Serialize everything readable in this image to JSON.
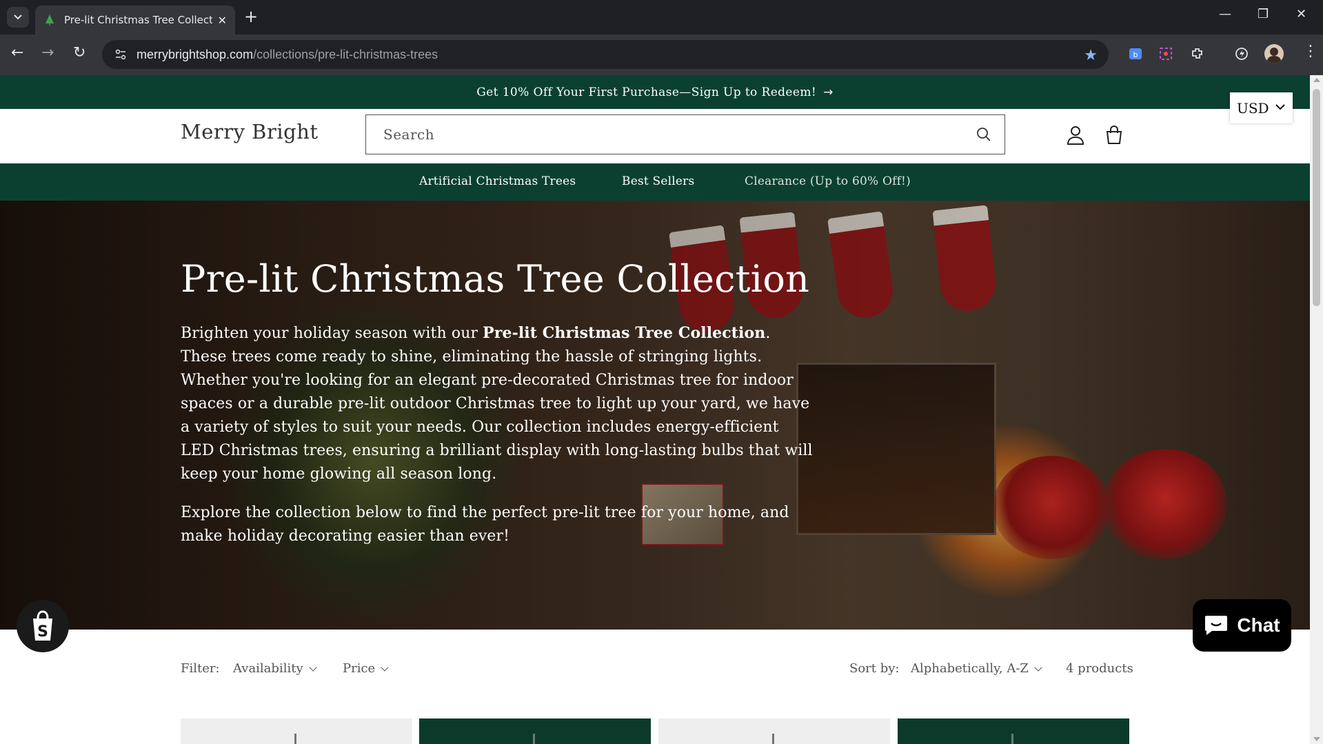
{
  "browser": {
    "tab_title": "Pre-lit Christmas Tree Collection",
    "tab_close": "✕",
    "new_tab": "+",
    "url_host": "merrybrightshop.com",
    "url_path": "/collections/pre-lit-christmas-trees",
    "window_controls": {
      "minimize": "—",
      "restore": "❐",
      "close": "✕"
    },
    "nav": {
      "back": "←",
      "forward": "→",
      "reload": "↻"
    }
  },
  "site": {
    "announcement": "Get 10% Off Your First Purchase—Sign Up to Redeem!",
    "announcement_arrow": "→",
    "currency": "USD",
    "logo": "Merry Bright",
    "search_placeholder": "Search",
    "nav": [
      {
        "label": "Artificial Christmas Trees"
      },
      {
        "label": "Best Sellers"
      },
      {
        "label": "Clearance (Up to 60% Off!)"
      }
    ],
    "brand_color": "#0b4030"
  },
  "hero": {
    "title": "Pre-lit Christmas Tree Collection",
    "p1_before": "Brighten your holiday season with our ",
    "p1_bold": "Pre-lit Christmas Tree Collection",
    "p1_after": ". These trees come ready to shine, eliminating the hassle of stringing lights. Whether you're looking for an elegant pre-decorated Christmas tree for indoor spaces or a durable pre-lit outdoor Christmas tree to light up your yard, we have a variety of styles to suit your needs. Our collection includes energy-efficient LED Christmas trees, ensuring a brilliant display with long-lasting bulbs that will keep your home glowing all season long.",
    "p2": "Explore the collection below to find the perfect pre-lit tree for your home, and make holiday decorating easier than ever!"
  },
  "filters": {
    "filter_label": "Filter:",
    "availability": "Availability",
    "price": "Price",
    "sort_label": "Sort by:",
    "sort_value": "Alphabetically, A-Z",
    "product_count": "4 products"
  },
  "products": [
    {
      "bg": "#eeeeee"
    },
    {
      "bg": "#0b3a2a"
    },
    {
      "bg": "#eeeeee"
    },
    {
      "bg": "#0b3a2a"
    }
  ],
  "chat": {
    "label": "Chat"
  },
  "icons": [
    "tab-list-icon",
    "tree-favicon",
    "site-info-icon",
    "star-icon",
    "search-icon",
    "account-icon",
    "cart-icon",
    "chevron-down-icon",
    "shopify-bag-icon",
    "chat-bubble-icon"
  ]
}
